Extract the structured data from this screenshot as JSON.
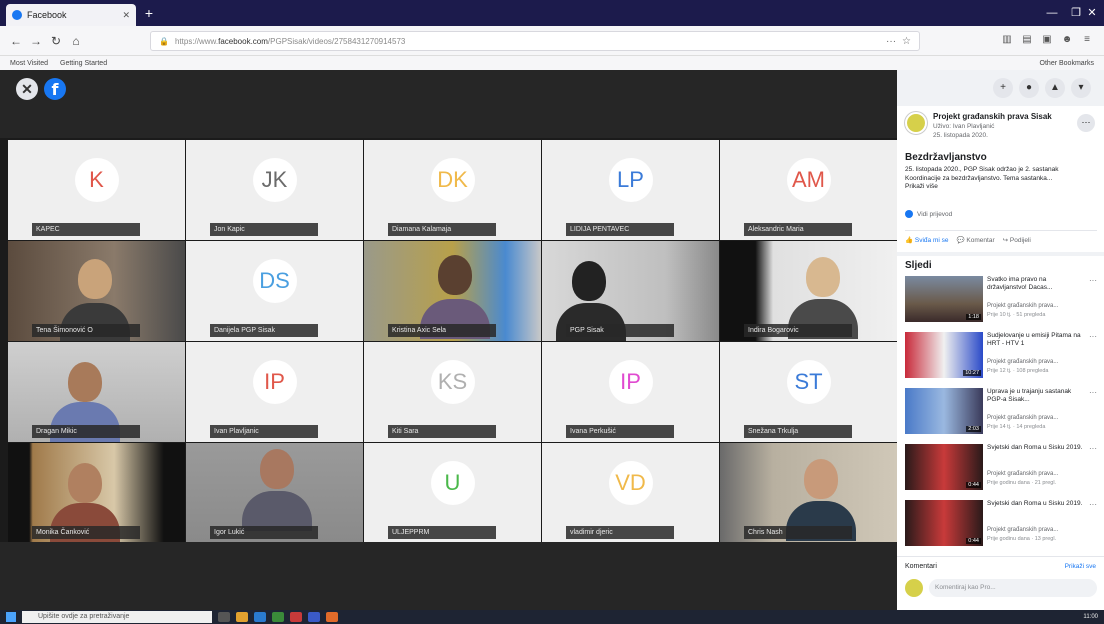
{
  "browser": {
    "tab_title": "Facebook",
    "url_prefix": "https://www.",
    "url_domain": "facebook.com",
    "url_rest": "/PGPSisak/videos/2758431270914573",
    "bookmarks": [
      "Most Visited",
      "Getting Started"
    ],
    "other_bookmarks": "Other Bookmarks"
  },
  "participants": [
    {
      "initials": "K",
      "name": "KAPEC",
      "color": "#e0574a"
    },
    {
      "initials": "JK",
      "name": "Jon Kapic",
      "color": "#6b6b6b"
    },
    {
      "initials": "DK",
      "name": "Diamana Kalamaja",
      "color": "#f0b94a"
    },
    {
      "initials": "LP",
      "name": "LIDIJA PENTAVEC",
      "color": "#3b7bd8"
    },
    {
      "initials": "AM",
      "name": "Aleksandric Maria",
      "color": "#e0574a"
    },
    {
      "initials": "",
      "name": "Tena Šimonović O",
      "color": ""
    },
    {
      "initials": "DS",
      "name": "Danijela PGP Sisak",
      "color": "#4a9fe0"
    },
    {
      "initials": "",
      "name": "Kristina Axic Sela",
      "color": ""
    },
    {
      "initials": "",
      "name": "PGP Sisak",
      "color": ""
    },
    {
      "initials": "",
      "name": "Indira Bogarovic",
      "color": ""
    },
    {
      "initials": "",
      "name": "Dragan Mikic",
      "color": ""
    },
    {
      "initials": "IP",
      "name": "Ivan Plavljanic",
      "color": "#e0574a"
    },
    {
      "initials": "KS",
      "name": "Kiti Sara",
      "color": "#b0b0b0"
    },
    {
      "initials": "IP",
      "name": "Ivana Perkušić",
      "color": "#e04ad0"
    },
    {
      "initials": "ST",
      "name": "Snežana Trkulja",
      "color": "#3b7bd8"
    },
    {
      "initials": "",
      "name": "Monika Čanković",
      "color": ""
    },
    {
      "initials": "",
      "name": "Igor Lukić",
      "color": ""
    },
    {
      "initials": "U",
      "name": "ULJEPPRM",
      "color": "#4ab84a"
    },
    {
      "initials": "VD",
      "name": "vladimir djeric",
      "color": "#f0b94a"
    },
    {
      "initials": "",
      "name": "Chris Nash",
      "color": ""
    }
  ],
  "post": {
    "page_name": "Projekt građanskih prava Sisak",
    "page_sub": "Uživo: Ivan Plavljanić",
    "date": "25. listopada 2020.",
    "title": "Bezdržavljanstvo",
    "text": "25. listopada 2020., PGP Sisak održao je 2. sastanak Koordinacije za bezdržavljanstvo. Tema sastanka...",
    "see_more": "Prikaži više",
    "translate": "Vidi prijevod",
    "like": "Sviđa mi se",
    "comment": "Komentar",
    "share": "Podijeli"
  },
  "follow_heading": "Sljedi",
  "videos": [
    {
      "title": "Svatko ima pravo na državljanstvo! Dacas...",
      "src": "Projekt građanskih prava...",
      "meta": "Prije 10 tj. · 51 pregleda",
      "dur": "1:18"
    },
    {
      "title": "Sudjelovanje u emisiji Pitama na HRT - HTV 1",
      "src": "Projekt građanskih prava...",
      "meta": "Prije 12 tj. · 108 pregleda",
      "dur": "10:27"
    },
    {
      "title": "Uprava je u trajanju sastanak PGP-a Sisak...",
      "src": "Projekt građanskih prava...",
      "meta": "Prije 14 tj. · 14 pregleda",
      "dur": "2:03"
    },
    {
      "title": "Svjetski dan Roma u Sisku 2019.",
      "src": "Projekt građanskih prava...",
      "meta": "Prije godinu dana · 21 pregl.",
      "dur": "0:44"
    },
    {
      "title": "Svjetski dan Roma u Sisku 2019.",
      "src": "Projekt građanskih prava...",
      "meta": "Prije godinu dana · 13 pregl.",
      "dur": "0:44"
    }
  ],
  "comments": {
    "label": "Komentari",
    "first": "Prikaži sve",
    "placeholder": "Komentiraj kao Pro..."
  },
  "taskbar": {
    "search": "Upišite ovdje za pretraživanje",
    "time": "11:00"
  }
}
